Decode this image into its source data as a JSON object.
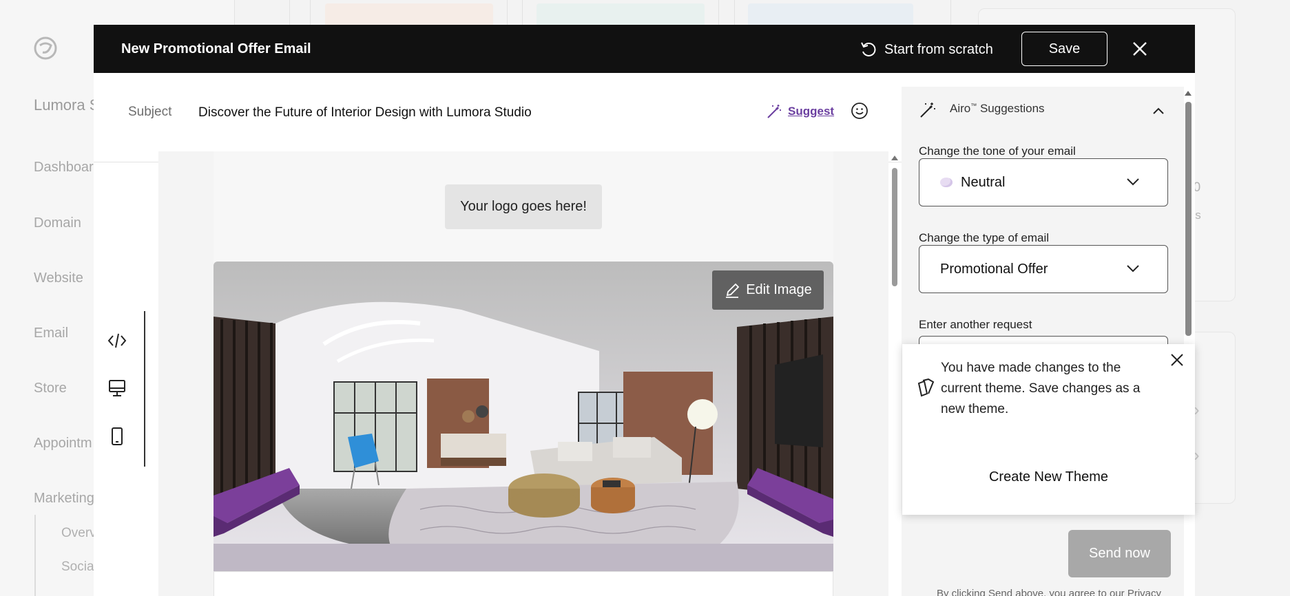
{
  "background": {
    "brand": "Lumora S",
    "nav": [
      "Dashboar",
      "Domain",
      "Website",
      "Email",
      "Store",
      "Appointm",
      "Marketing"
    ],
    "subnav": [
      "Overv",
      "Socia"
    ],
    "card_value": "00",
    "card_text": "his"
  },
  "modal": {
    "title": "New Promotional Offer Email",
    "start_from_scratch": "Start from scratch",
    "save_label": "Save"
  },
  "subject": {
    "label": "Subject",
    "value": "Discover the Future of Interior Design with Lumora Studio",
    "suggest_label": "Suggest"
  },
  "canvas": {
    "logo_placeholder": "Your logo goes here!",
    "edit_image_label": "Edit Image"
  },
  "airo": {
    "title": "Airo",
    "title_mark": "™",
    "title_suffix": " Suggestions",
    "tone_label": "Change the tone of your email",
    "tone_value": "Neutral",
    "type_label": "Change the type of email",
    "type_value": "Promotional Offer",
    "request_label": "Enter another request"
  },
  "popover": {
    "message": "You have made changes to the current theme. Save changes as a new theme.",
    "button_label": "Create New Theme"
  },
  "send": {
    "label": "Send now",
    "fine_print": "By clicking Send above, you agree to our Privacy"
  },
  "colors": {
    "header_bg": "#111111",
    "suggest_purple": "#6b3fa0",
    "panel_bg": "#f4f4f4",
    "send_disabled": "#a8a8a8"
  }
}
